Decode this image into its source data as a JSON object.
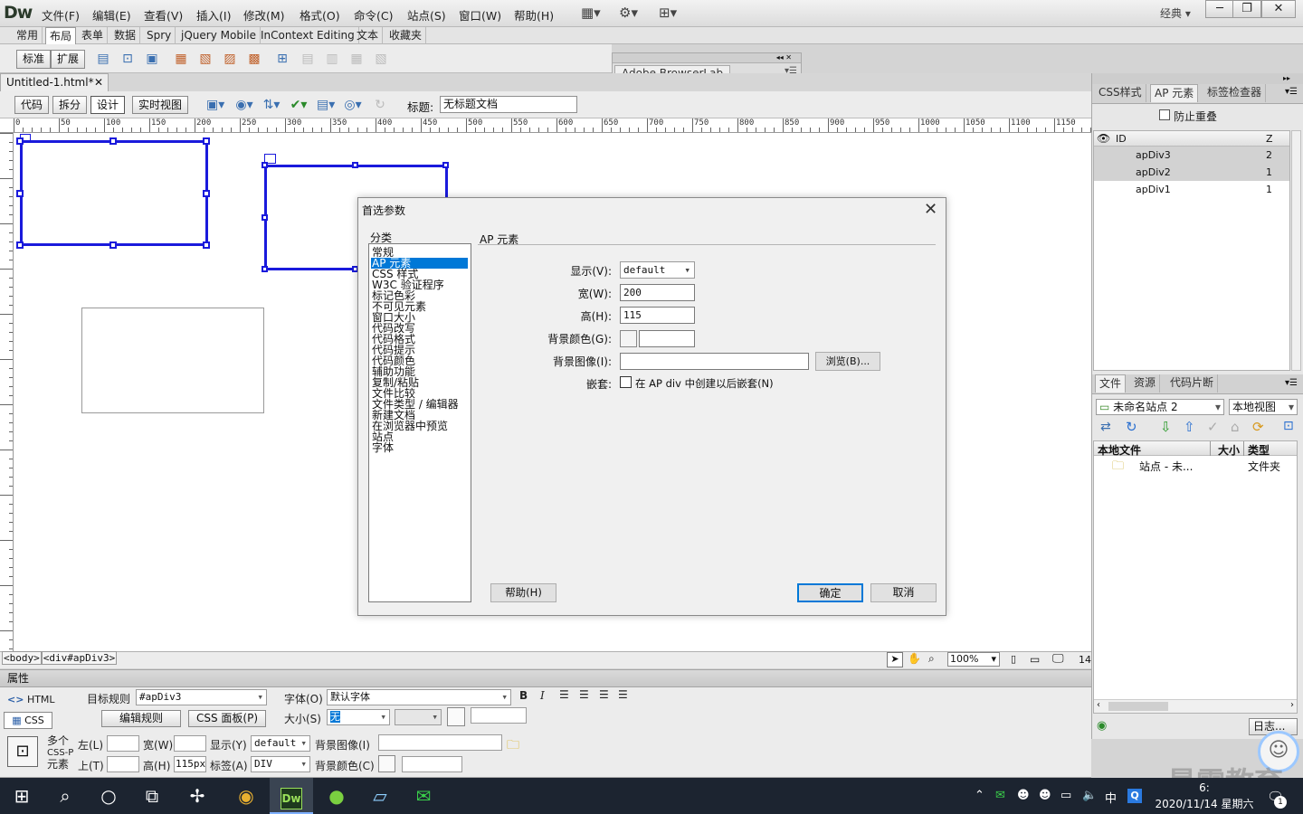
{
  "app": {
    "logo": "Dw",
    "workspace": "经典"
  },
  "menu": [
    "文件(F)",
    "编辑(E)",
    "查看(V)",
    "插入(I)",
    "修改(M)",
    "格式(O)",
    "命令(C)",
    "站点(S)",
    "窗口(W)",
    "帮助(H)"
  ],
  "insert_tabs": [
    "常用",
    "布局",
    "表单",
    "数据",
    "Spry",
    "jQuery Mobile",
    "InContext Editing",
    "文本",
    "收藏夹"
  ],
  "insert_tab_active": "布局",
  "layout_modes": [
    "标准",
    "扩展"
  ],
  "browserlab_tab": "Adobe BrowserLab",
  "doc_tab": "Untitled-1.html*",
  "view_buttons": [
    "代码",
    "拆分",
    "设计",
    "实时视图"
  ],
  "title_label": "标题:",
  "title_value": "无标题文档",
  "ruler_labels": [
    "0",
    "50",
    "100",
    "150",
    "200",
    "250",
    "300",
    "350",
    "400",
    "450",
    "500",
    "550",
    "600",
    "650",
    "700",
    "750",
    "800",
    "850",
    "900",
    "950",
    "1000",
    "1050",
    "1100",
    "1150"
  ],
  "status": {
    "tag_body": "<body>",
    "tag_div": "<div#apDiv3>",
    "zoom": "100%",
    "num": "14"
  },
  "properties": {
    "header": "属性",
    "html_btn": "HTML",
    "css_btn": "CSS",
    "target_rule_label": "目标规则",
    "target_rule_value": "#apDiv3",
    "edit_rule_btn": "编辑规则",
    "css_panel_btn": "CSS 面板(P)",
    "font_label": "字体(O)",
    "font_value": "默认字体",
    "size_label": "大小(S)",
    "size_value": "无",
    "bold": "B",
    "italic": "I",
    "elem_label_1": "多个",
    "elem_label_2": "CSS-P",
    "elem_label_3": "元素",
    "left_label": "左(L)",
    "top_label": "上(T)",
    "width_label": "宽(W)",
    "height_label": "高(H)",
    "height_value": "115px",
    "display_label": "显示(Y)",
    "display_value": "default",
    "tag_label": "标签(A)",
    "tag_value": "DIV",
    "bgimg_label": "背景图像(I)",
    "bgcolor_label": "背景颜色(C)"
  },
  "ap_panel": {
    "tabs": [
      "CSS样式",
      "AP 元素",
      "标签检查器"
    ],
    "active_tab": "AP 元素",
    "prevent_overlap": "防止重叠",
    "col_id": "ID",
    "col_z": "Z",
    "rows": [
      {
        "id": "apDiv3",
        "z": "2",
        "selected": true
      },
      {
        "id": "apDiv2",
        "z": "1",
        "selected": true
      },
      {
        "id": "apDiv1",
        "z": "1",
        "selected": false
      }
    ]
  },
  "files_panel": {
    "tabs": [
      "文件",
      "资源",
      "代码片断"
    ],
    "site": "未命名站点 2",
    "view": "本地视图",
    "col_local": "本地文件",
    "col_size": "大小",
    "col_type": "类型",
    "row_name": "站点 - 未...",
    "row_type": "文件夹",
    "log_btn": "日志..."
  },
  "dialog": {
    "title": "首选参数",
    "category_label": "分类",
    "categories": [
      "常规",
      "AP 元素",
      "CSS 样式",
      "W3C 验证程序",
      "标记色彩",
      "不可见元素",
      "窗口大小",
      "代码改写",
      "代码格式",
      "代码提示",
      "代码颜色",
      "辅助功能",
      "复制/粘贴",
      "文件比较",
      "文件类型 / 编辑器",
      "新建文档",
      "在浏览器中预览",
      "站点",
      "字体"
    ],
    "selected_category": "AP 元素",
    "section_title": "AP 元素",
    "display_label": "显示(V):",
    "display_value": "default",
    "width_label": "宽(W):",
    "width_value": "200",
    "height_label": "高(H):",
    "height_value": "115",
    "bgcolor_label": "背景颜色(G):",
    "bgimage_label": "背景图像(I):",
    "browse_btn": "浏览(B)...",
    "nest_label": "嵌套:",
    "nest_checkbox": "在 AP div 中创建以后嵌套(N)",
    "help_btn": "帮助(H)",
    "ok_btn": "确定",
    "cancel_btn": "取消"
  },
  "taskbar": {
    "time": "6:",
    "date": "2020/11/14 星期六",
    "ime": "中",
    "badge": "1"
  },
  "watermark": "最需教育",
  "colors": {
    "ap_border": "#1a1adc",
    "selection": "#0078d7",
    "taskbar": "#1c2430"
  }
}
